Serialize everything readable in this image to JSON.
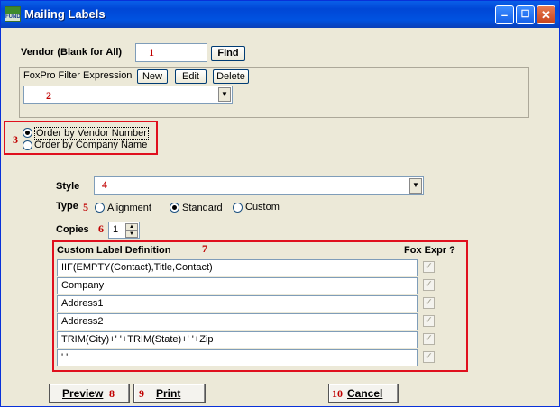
{
  "window": {
    "title": "Mailing Labels",
    "icon_text": "FUND",
    "minimize": "–",
    "maximize": "☐",
    "close": "✕"
  },
  "vendor": {
    "label": "Vendor (Blank for All)",
    "value": "",
    "find_label": "Find"
  },
  "filter": {
    "label": "FoxPro Filter Expression",
    "new_label": "New",
    "edit_label": "Edit",
    "delete_label": "Delete",
    "value": ""
  },
  "order": {
    "options": [
      "Order by Vendor Number",
      "Order by Company Name"
    ],
    "selected": 0
  },
  "style": {
    "label": "Style",
    "value": ""
  },
  "type": {
    "label": "Type",
    "options": [
      "Alignment",
      "Standard",
      "Custom"
    ],
    "selected": 1
  },
  "copies": {
    "label": "Copies",
    "value": "1"
  },
  "custom": {
    "label": "Custom Label Definition",
    "fox_label": "Fox Expr ?",
    "rows": [
      {
        "expr": "IIF(EMPTY(Contact),Title,Contact)",
        "fox": true
      },
      {
        "expr": "Company",
        "fox": true
      },
      {
        "expr": "Address1",
        "fox": true
      },
      {
        "expr": "Address2",
        "fox": true
      },
      {
        "expr": "TRIM(City)+'  '+TRIM(State)+'  '+Zip",
        "fox": true
      },
      {
        "expr": "' '",
        "fox": true
      }
    ]
  },
  "buttons": {
    "preview": "Preview",
    "print": "Print",
    "cancel": "Cancel"
  },
  "annotations": [
    "1",
    "2",
    "3",
    "4",
    "5",
    "6",
    "7",
    "8",
    "9",
    "10"
  ],
  "colors": {
    "annotation": "#c00000",
    "highlight_box": "#e0101e",
    "titlebar": "#0052e0"
  }
}
